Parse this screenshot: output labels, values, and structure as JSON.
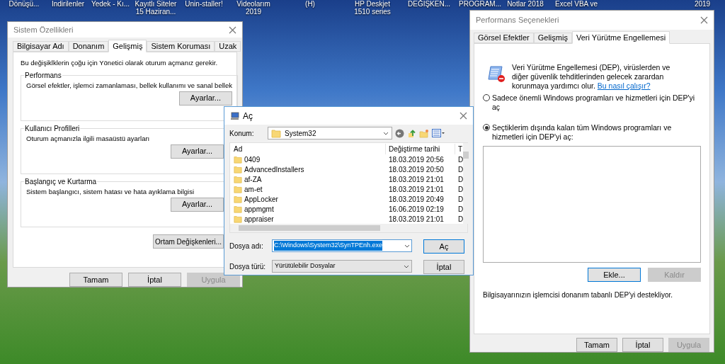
{
  "desktop_icons": [
    {
      "lines": [
        "Dönüşü..."
      ]
    },
    {
      "lines": [
        "İndirilenler"
      ]
    },
    {
      "lines": [
        "Yedek - Kı..."
      ]
    },
    {
      "lines": [
        "Kayıtlı Siteler",
        "15 Haziran..."
      ]
    },
    {
      "lines": [
        "Unin-staller!"
      ]
    },
    {
      "lines": [
        "Videolarım",
        "2019"
      ]
    },
    {
      "lines": [
        "(H)"
      ]
    },
    {
      "lines": [
        "HP Deskjet",
        "1510 series"
      ]
    },
    {
      "lines": [
        "DEĞİŞKEN..."
      ]
    },
    {
      "lines": [
        "PROGRAM..."
      ]
    },
    {
      "lines": [
        "Notlar 2018"
      ]
    },
    {
      "lines": [
        "Excel VBA ve"
      ]
    },
    {
      "lines": [
        "2019"
      ]
    }
  ],
  "system_properties": {
    "title": "Sistem Özellikleri",
    "tabs": [
      {
        "label": "Bilgisayar Adı",
        "selected": false
      },
      {
        "label": "Donanım",
        "selected": false
      },
      {
        "label": "Gelişmiş",
        "selected": true
      },
      {
        "label": "Sistem Koruması",
        "selected": false
      },
      {
        "label": "Uzak",
        "selected": false
      }
    ],
    "intro": "Bu değişiklklerin çoğu için Yönetici olarak oturum açmanız gerekir.",
    "groups": [
      {
        "title": "Performans",
        "description": "Görsel efektler, işlemci zamanlaması, bellek kullanımı ve sanal bellek",
        "button": "Ayarlar..."
      },
      {
        "title": "Kullanıcı Profilleri",
        "description": "Oturum açmanızla ilgili masaüstü ayarları",
        "button": "Ayarlar..."
      },
      {
        "title": "Başlangıç ve Kurtarma",
        "description": "Sistem başlangıcı, sistem hatası ve hata ayıklama bilgisi",
        "button": "Ayarlar..."
      }
    ],
    "env_button": "Ortam Değişkenleri...",
    "buttons": [
      {
        "label": "Tamam",
        "disabled": false
      },
      {
        "label": "İptal",
        "disabled": false
      },
      {
        "label": "Uygula",
        "disabled": true
      }
    ]
  },
  "open_dialog": {
    "title": "Aç",
    "location_label": "Konum:",
    "location": "System32",
    "columns": [
      "Ad",
      "Değiştirme tarihi",
      "T"
    ],
    "rows": [
      {
        "name": "0409",
        "date": "18.03.2019 20:56",
        "type": "D"
      },
      {
        "name": "AdvancedInstallers",
        "date": "18.03.2019 20:50",
        "type": "D"
      },
      {
        "name": "af-ZA",
        "date": "18.03.2019 21:01",
        "type": "D"
      },
      {
        "name": "am-et",
        "date": "18.03.2019 21:01",
        "type": "D"
      },
      {
        "name": "AppLocker",
        "date": "18.03.2019 20:49",
        "type": "D"
      },
      {
        "name": "appmgmt",
        "date": "16.06.2019 02:19",
        "type": "D"
      },
      {
        "name": "appraiser",
        "date": "18.03.2019 21:01",
        "type": "D"
      }
    ],
    "file_name_label": "Dosya adı:",
    "file_name": "C:\\Windows\\System32\\SynTPEnh.exe",
    "file_type_label": "Dosya türü:",
    "file_type": "Yürütülebilir Dosyalar",
    "buttons": [
      {
        "label": "Aç",
        "default": true
      },
      {
        "label": "İptal",
        "default": false
      }
    ]
  },
  "performance_options": {
    "title": "Performans Seçenekleri",
    "tabs": [
      {
        "label": "Görsel Efektler",
        "selected": false
      },
      {
        "label": "Gelişmiş",
        "selected": false
      },
      {
        "label": "Veri Yürütme Engellemesi",
        "selected": true
      }
    ],
    "description": "Veri Yürütme Engellemesi (DEP), virüslerden ve diğer güvenlik tehditlerinden gelecek zarardan korunmaya yardımcı olur.",
    "link": "Bu nasıl çalışır?",
    "radios": [
      {
        "label": "Sadece önemli Windows programları ve hizmetleri için DEP'yi aç",
        "selected": false
      },
      {
        "label": "Seçtiklerim dışında kalan tüm Windows programları ve hizmetleri için DEP'yi aç:",
        "selected": true
      }
    ],
    "list_buttons": [
      {
        "label": "Ekle...",
        "disabled": false,
        "focused": true
      },
      {
        "label": "Kaldır",
        "disabled": true,
        "focused": false
      }
    ],
    "note": "Bilgisayarınızın işlemcisi donanım tabanlı DEP'yi destekliyor.",
    "buttons": [
      {
        "label": "Tamam",
        "disabled": false
      },
      {
        "label": "İptal",
        "disabled": false
      },
      {
        "label": "Uygula",
        "disabled": true
      }
    ]
  }
}
